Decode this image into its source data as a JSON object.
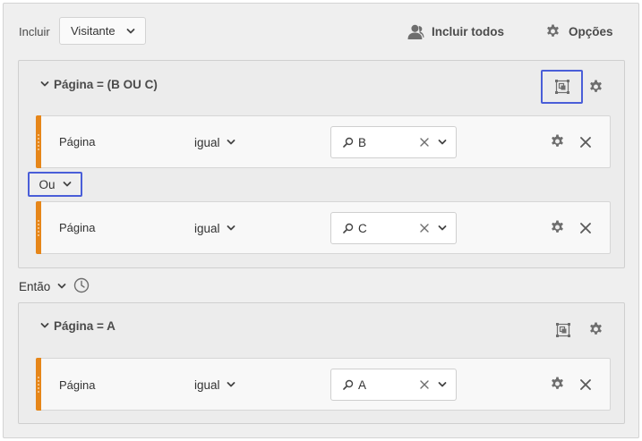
{
  "header": {
    "include_label": "Incluir",
    "scope_value": "Visitante",
    "include_all_label": "Incluir todos",
    "options_label": "Opções"
  },
  "containers": [
    {
      "title": "Página = (B OU C)",
      "rules": [
        {
          "dimension": "Página",
          "operator": "igual",
          "value": "B"
        },
        {
          "dimension": "Página",
          "operator": "igual",
          "value": "C"
        }
      ],
      "logic_operator": "Ou"
    },
    {
      "title": "Página = A",
      "rules": [
        {
          "dimension": "Página",
          "operator": "igual",
          "value": "A"
        }
      ]
    }
  ],
  "sequence": {
    "then_label": "Então"
  },
  "icons": {
    "person": "person-icon",
    "gear": "gear-icon",
    "chevron": "chevron-down-icon",
    "container": "container-icon",
    "search": "search-icon",
    "clear": "clear-icon",
    "close": "close-icon",
    "clock": "clock-icon"
  },
  "colors": {
    "accent_orange": "#e68619",
    "highlight_blue": "#4a5ed8",
    "icon_gray": "#6e6e6e"
  }
}
